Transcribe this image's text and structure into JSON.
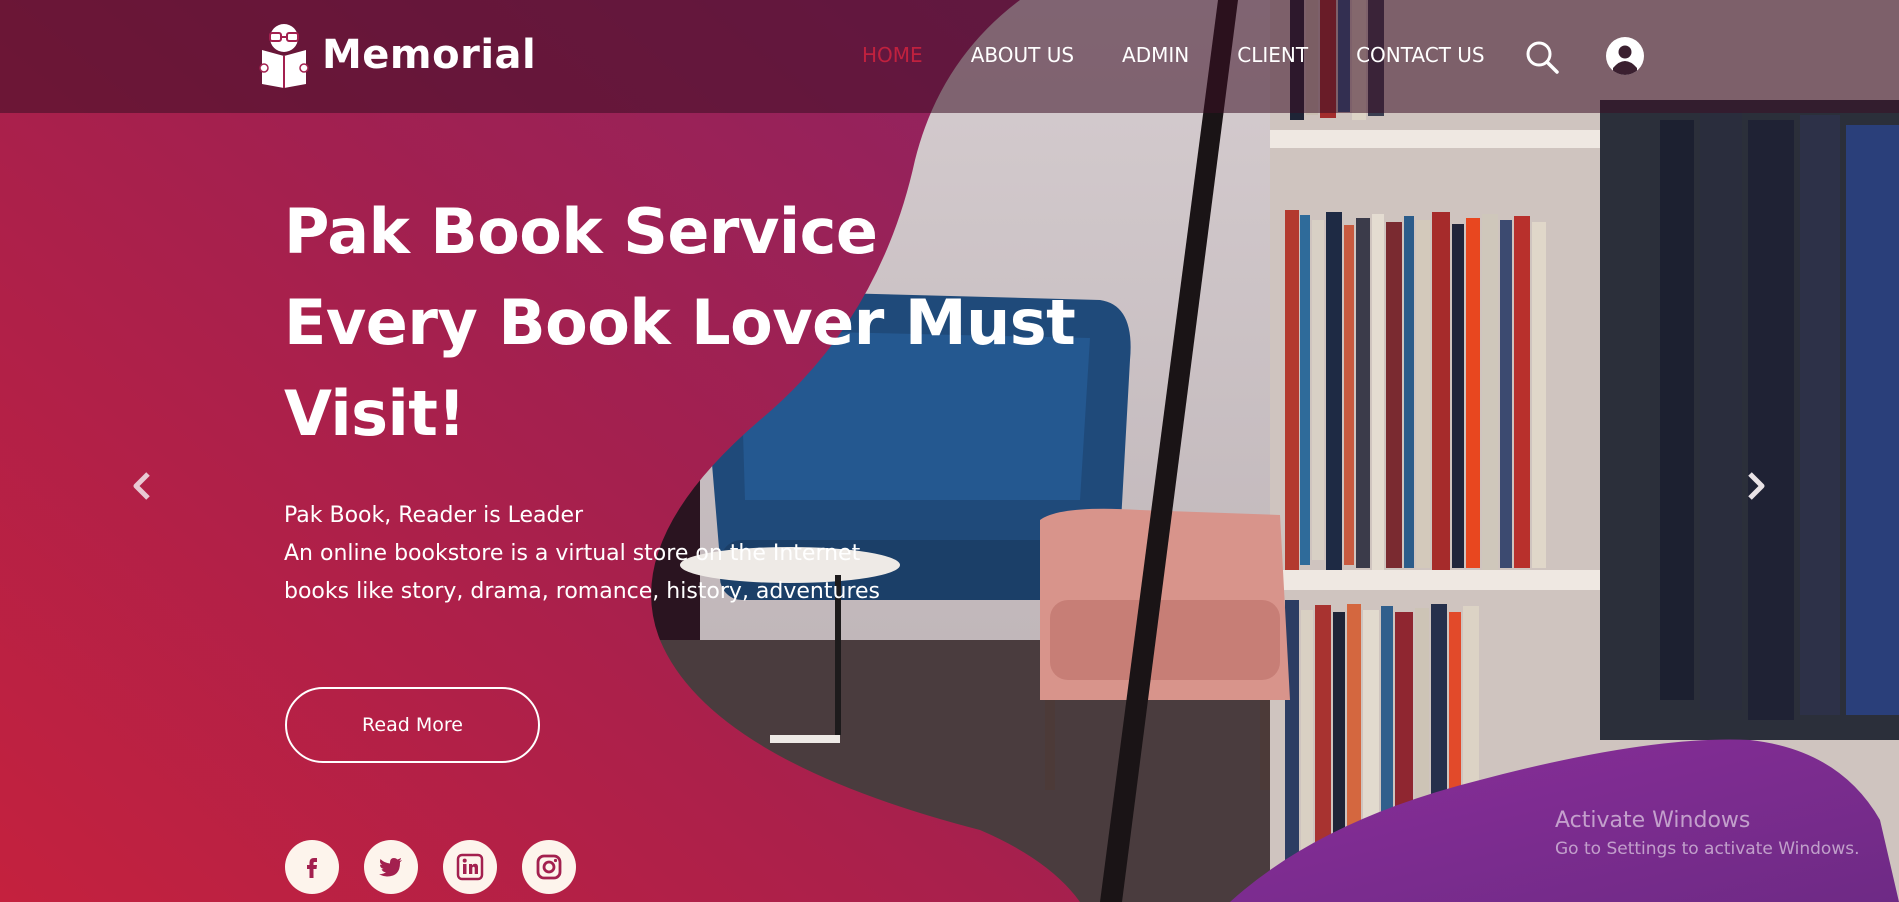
{
  "brand": {
    "name": "Memorial",
    "logo_icon": "reader-with-book-icon"
  },
  "nav": {
    "items": [
      {
        "label": "HOME",
        "active": true
      },
      {
        "label": "ABOUT US",
        "active": false
      },
      {
        "label": "ADMIN",
        "active": false
      },
      {
        "label": "CLIENT",
        "active": false
      },
      {
        "label": "CONTACT US",
        "active": false
      }
    ],
    "search_icon": "search-icon",
    "user_icon": "user-icon"
  },
  "hero": {
    "title_lines": [
      "Pak Book Service",
      "Every Book Lover Must",
      "Visit!"
    ],
    "description_lines": [
      "Pak Book, Reader is Leader",
      "An online bookstore is a virtual store on the Internet",
      "books like story, drama, romance, history, adventures"
    ],
    "read_more_label": "Read More"
  },
  "carousel": {
    "prev_icon": "chevron-left-icon",
    "next_icon": "chevron-right-icon"
  },
  "socials": [
    {
      "name": "facebook-icon",
      "glyph": "f"
    },
    {
      "name": "twitter-icon",
      "glyph": "t"
    },
    {
      "name": "linkedin-icon",
      "glyph": "in"
    },
    {
      "name": "instagram-icon",
      "glyph": "ig"
    }
  ],
  "watermark": {
    "title": "Activate Windows",
    "subtitle": "Go to Settings to activate Windows."
  },
  "colors": {
    "accent_active": "#c0213e",
    "gradient_left": "#c4213e",
    "gradient_right": "#8a2460",
    "header_overlay": "#4a1530",
    "purple_blob": "#7a2b93"
  }
}
